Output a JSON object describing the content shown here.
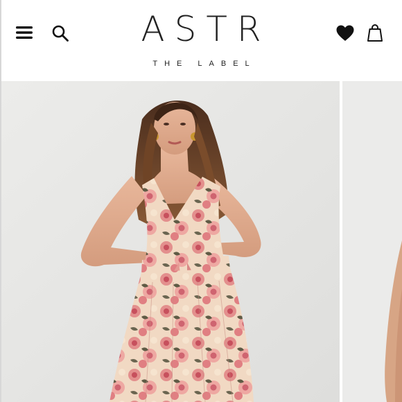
{
  "header": {
    "brand_logo": "ASTR",
    "brand_tagline": "THE LABEL",
    "icons": {
      "menu": "menu-icon",
      "search": "search-icon",
      "wishlist": "heart-icon",
      "bag": "shopping-bag-icon"
    }
  },
  "gallery": {
    "background_color": "#e9e9e7",
    "dress_colors": [
      "#e49a93",
      "#f3dcc0",
      "#5c5b45",
      "#c5525e"
    ]
  }
}
